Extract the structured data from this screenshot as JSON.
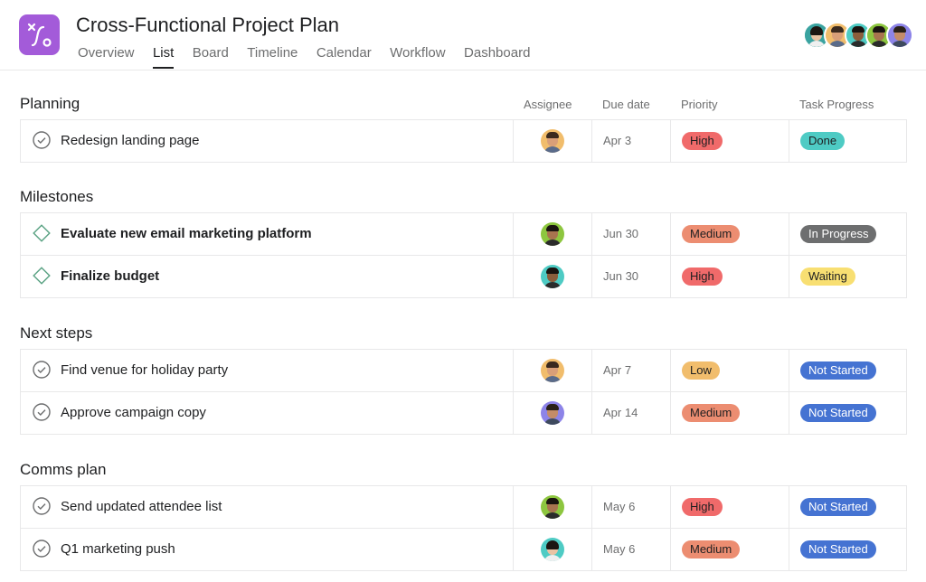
{
  "project": {
    "title": "Cross-Functional Project Plan",
    "icon": "project-route-icon",
    "icon_color": "#a35bd9"
  },
  "tabs": [
    {
      "label": "Overview",
      "active": false
    },
    {
      "label": "List",
      "active": true
    },
    {
      "label": "Board",
      "active": false
    },
    {
      "label": "Timeline",
      "active": false
    },
    {
      "label": "Calendar",
      "active": false
    },
    {
      "label": "Workflow",
      "active": false
    },
    {
      "label": "Dashboard",
      "active": false
    }
  ],
  "columns": {
    "assignee": "Assignee",
    "due_date": "Due date",
    "priority": "Priority",
    "progress": "Task Progress"
  },
  "sections": [
    {
      "title": "Planning",
      "tasks": [
        {
          "name": "Redesign landing page",
          "type": "task",
          "due": "Apr 3",
          "priority": "High",
          "progress": "Done"
        }
      ]
    },
    {
      "title": "Milestones",
      "tasks": [
        {
          "name": "Evaluate new email marketing platform",
          "type": "milestone",
          "due": "Jun 30",
          "priority": "Medium",
          "progress": "In Progress"
        },
        {
          "name": "Finalize budget",
          "type": "milestone",
          "due": "Jun 30",
          "priority": "High",
          "progress": "Waiting"
        }
      ]
    },
    {
      "title": "Next steps",
      "tasks": [
        {
          "name": "Find venue for holiday party",
          "type": "task",
          "due": "Apr 7",
          "priority": "Low",
          "progress": "Not Started"
        },
        {
          "name": "Approve campaign copy",
          "type": "task",
          "due": "Apr 14",
          "priority": "Medium",
          "progress": "Not Started"
        }
      ]
    },
    {
      "title": "Comms plan",
      "tasks": [
        {
          "name": "Send updated attendee list",
          "type": "task",
          "due": "May 6",
          "priority": "High",
          "progress": "Not Started"
        },
        {
          "name": "Q1 marketing push",
          "type": "task",
          "due": "May 6",
          "priority": "Medium",
          "progress": "Not Started"
        }
      ]
    }
  ],
  "colors": {
    "priority": {
      "High": "#f06a6a",
      "Medium": "#ec8d71",
      "Low": "#f1bd6c"
    },
    "progress": {
      "Done": "#4ecbc4",
      "In Progress": "#6d6e6f",
      "Waiting": "#f8df72",
      "Not Started": "#4573d2"
    },
    "progress_text": {
      "Done": "#1e1f21",
      "In Progress": "#ffffff",
      "Waiting": "#1e1f21",
      "Not Started": "#ffffff"
    }
  }
}
